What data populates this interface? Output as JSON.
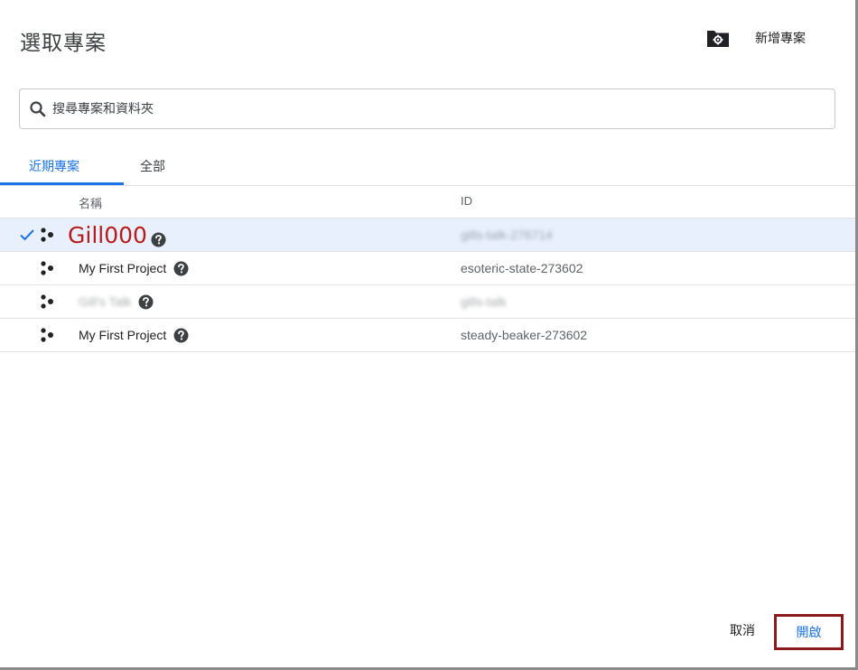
{
  "dialog": {
    "title": "選取專案",
    "new_project_label": "新增專案"
  },
  "search": {
    "placeholder": "搜尋專案和資料夾",
    "value": ""
  },
  "tabs": [
    {
      "label": "近期專案",
      "active": true
    },
    {
      "label": "全部",
      "active": false
    }
  ],
  "table": {
    "columns": [
      "名稱",
      "ID"
    ],
    "rows": [
      {
        "name": "Gill000",
        "id": "gills-talk-276714",
        "selected": true,
        "blurred_id": true
      },
      {
        "name": "My First Project",
        "id": "esoteric-state-273602",
        "selected": false
      },
      {
        "name": "Gill's Talk",
        "id": "gills-talk",
        "selected": false,
        "blurred_name": true,
        "blurred_id": true
      },
      {
        "name": "My First Project",
        "id": "steady-beaker-273602",
        "selected": false
      }
    ]
  },
  "footer": {
    "cancel_label": "取消",
    "open_label": "開啟"
  },
  "colors": {
    "accent": "#1a73e8",
    "selected_row_bg": "#e8f0fe",
    "annotation_red": "#b71c1c",
    "annotation_box": "#8b1a1a"
  },
  "icons": {
    "new_project": "folder-settings-icon",
    "search": "search-icon",
    "project": "project-icon",
    "help": "help-icon",
    "check": "check-icon"
  }
}
